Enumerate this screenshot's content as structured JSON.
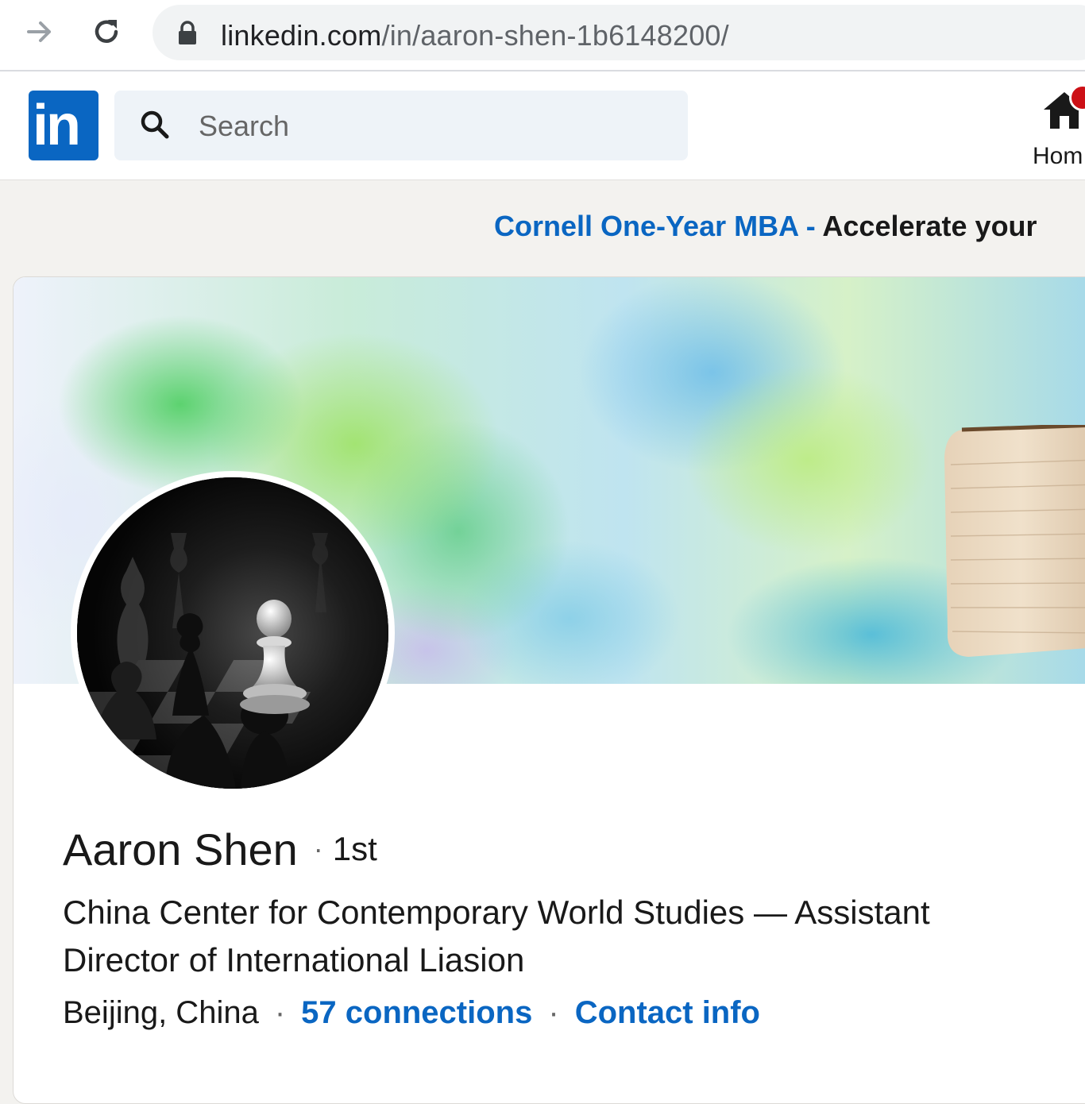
{
  "browser": {
    "url_host": "linkedin.com",
    "url_path": "/in/aaron-shen-1b6148200/",
    "forward_icon": "arrow-right-icon",
    "reload_icon": "reload-icon",
    "lock_icon": "lock-icon"
  },
  "header": {
    "logo_text": "in",
    "search_placeholder": "Search",
    "home_label": "Hom"
  },
  "ad": {
    "link_text": "Cornell One-Year MBA -",
    "text": " Accelerate your"
  },
  "profile": {
    "name": "Aaron Shen",
    "separator": "·",
    "degree": "1st",
    "headline": "China Center for Contemporary World Studies — Assistant Director of International Liasion",
    "location": "Beijing, China",
    "connections": "57 connections",
    "contact_info": "Contact info"
  },
  "colors": {
    "brand_blue": "#0a66c2",
    "page_bg": "#f3f2ef",
    "search_bg": "#eef3f8",
    "notification_red": "#cc1016"
  }
}
